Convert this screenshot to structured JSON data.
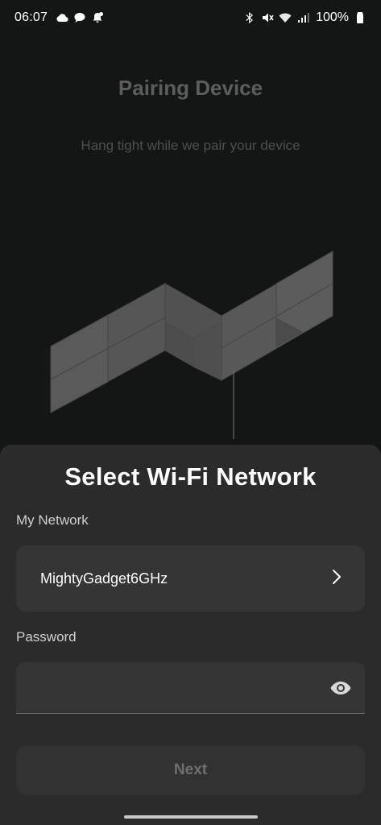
{
  "status_bar": {
    "time": "06:07",
    "battery_percent": "100%",
    "left_icons": [
      "cloud-icon",
      "chat-bubble-icon",
      "notification-bell-icon"
    ],
    "right_icons": [
      "bluetooth-icon",
      "mute-icon",
      "wifi-icon",
      "signal-icon",
      "battery-icon"
    ]
  },
  "background": {
    "title": "Pairing Device",
    "subtitle": "Hang tight while we pair your device"
  },
  "sheet": {
    "title": "Select Wi-Fi Network",
    "network_label": "My Network",
    "network_value": "MightyGadget6GHz",
    "password_label": "Password",
    "password_value": "",
    "next_label": "Next"
  },
  "colors": {
    "background": "#141515",
    "sheet": "#2b2b2b",
    "field": "#353535",
    "disabled_text": "#6f6f6f"
  }
}
